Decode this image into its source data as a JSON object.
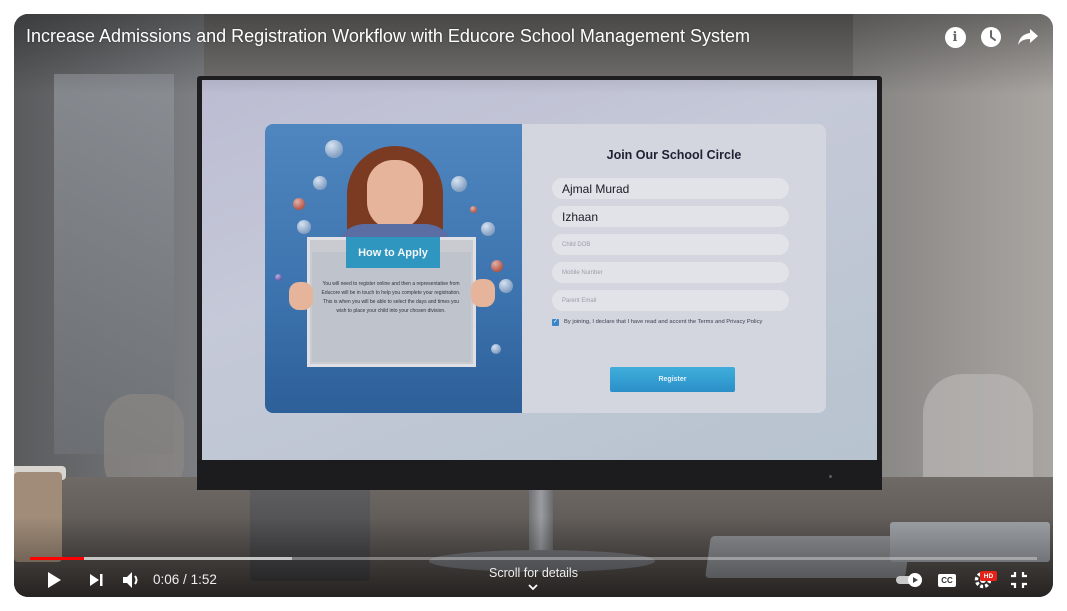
{
  "player": {
    "title": "Increase Admissions and Registration Workflow with Educore School Management System",
    "time_current": "0:06",
    "time_separator": "/",
    "time_total": "1:52",
    "progress_played": 0.054,
    "progress_buffered": 0.26,
    "scroll_hint": "Scroll for details",
    "hd_badge": "HD",
    "cc_label": "CC",
    "info_glyph": "i"
  },
  "video_frame": {
    "form_title": "Join Our School Circle",
    "fields": [
      {
        "value": "Ajmal Murad",
        "placeholder": ""
      },
      {
        "value": "Izhaan",
        "placeholder": ""
      },
      {
        "value": "",
        "placeholder": "Child DOB"
      },
      {
        "value": "",
        "placeholder": "Mobile Number"
      },
      {
        "value": "",
        "placeholder": "Parent Email"
      }
    ],
    "agree_text": "By joining, I declare that I have read and accent the Terms and Privacy Policy",
    "register_label": "Register",
    "apply_heading": "How to Apply",
    "apply_text": "You will need to register online and then a representative from Educore will be in touch to help you complete your registration. This is when you will be able to select the days and times you wish to place your child into your chosen division."
  },
  "icons": [
    "info-icon",
    "watch-later-icon",
    "share-icon",
    "play-icon",
    "next-icon",
    "volume-icon",
    "autoplay-toggle-icon",
    "captions-icon",
    "settings-icon",
    "exit-fullscreen-icon",
    "chevron-down-icon"
  ],
  "colors": {
    "progress_played": "#ff0000",
    "hd_badge": "#e62117",
    "register_button": "#2a8fc7"
  }
}
